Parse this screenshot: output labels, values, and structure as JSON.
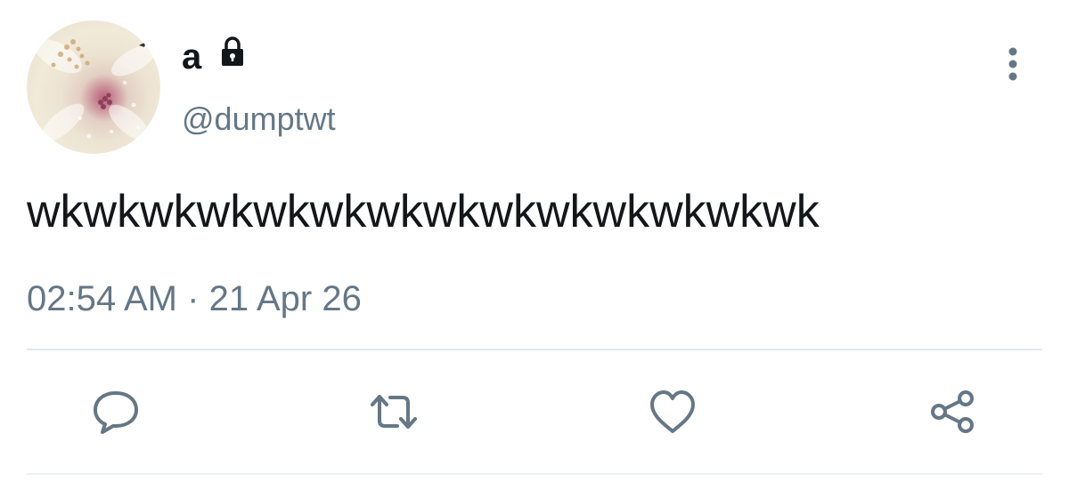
{
  "user": {
    "display_name": "a",
    "handle": "@dumptwt",
    "avatar_icon": "avatar",
    "protected_icon": "lock-icon"
  },
  "tweet": {
    "text": "wkwkwkwkwkwkwkwkwkwkwkwkwkwk",
    "time": "02:54 AM",
    "separator": "·",
    "date": "21 Apr 26"
  },
  "actions": [
    {
      "name": "reply",
      "icon": "speech-bubble-icon"
    },
    {
      "name": "retweet",
      "icon": "retweet-arrows-icon"
    },
    {
      "name": "like",
      "icon": "heart-icon"
    },
    {
      "name": "share",
      "icon": "share-nodes-icon"
    }
  ],
  "menu_icon": "vertical-ellipsis-icon",
  "colors": {
    "text_primary": "#14171a",
    "text_secondary": "#657786",
    "icon": "#657786",
    "divider": "#e1e8ed",
    "background": "#ffffff"
  }
}
